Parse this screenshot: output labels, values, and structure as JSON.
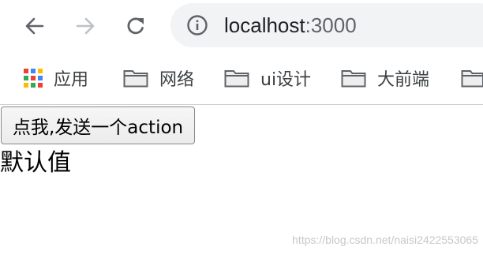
{
  "browser": {
    "url_host": "localhost",
    "url_port": ":3000",
    "icons": {
      "back": "back-arrow-icon",
      "forward": "forward-arrow-icon",
      "reload": "reload-icon",
      "info": "info-icon"
    }
  },
  "bookmarks": [
    {
      "label": "应用",
      "icon": "apps-grid-icon"
    },
    {
      "label": "网络",
      "icon": "folder-icon"
    },
    {
      "label": "ui设计",
      "icon": "folder-icon"
    },
    {
      "label": "大前端",
      "icon": "folder-icon"
    },
    {
      "label": "",
      "icon": "folder-icon"
    }
  ],
  "page": {
    "button_label": "点我,发送一个action",
    "value_text": "默认值"
  },
  "watermark": "https://blog.csdn.net/naisi2422553065"
}
